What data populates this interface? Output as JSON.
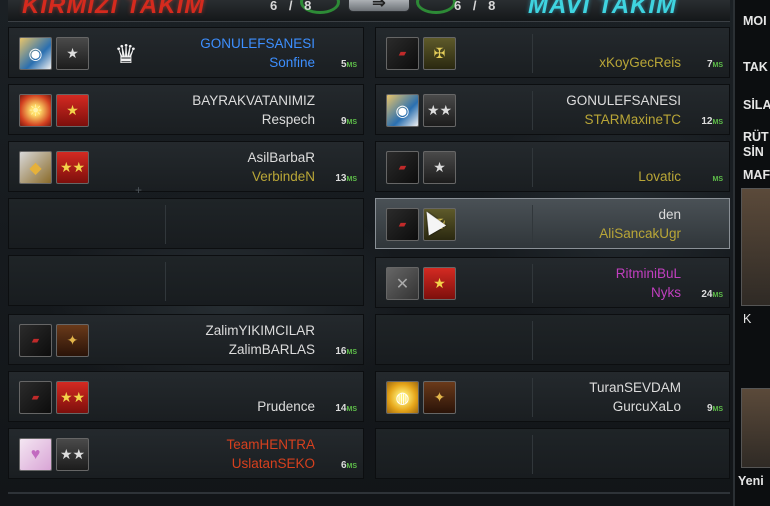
{
  "header": {
    "red_team": "KIRMIZI TAKIM",
    "red_count": "6 / 8",
    "blue_team": "MAVİ TAKIM",
    "blue_count": "6 / 8",
    "swap_label": "⇒"
  },
  "red_slots": [
    {
      "name1": "GONULEFSANESI",
      "name2": "Sonfine",
      "ping": "5",
      "name1_color": "blue",
      "name2_color": "blue"
    },
    {
      "name1": "BAYRAKVATANIMIZ",
      "name2": "Respech",
      "ping": "9"
    },
    {
      "name1": "AsilBarbaR",
      "name2": "VerbindeN",
      "ping": "13"
    },
    {
      "empty": true
    },
    {
      "empty": true
    },
    {
      "name1": "ZalimYIKIMCILAR",
      "name2": "ZalimBARLAS",
      "ping": "16"
    },
    {
      "name1": "",
      "name2": "Prudence",
      "ping": "14"
    },
    {
      "name1": "TeamHENTRA",
      "name2": "UslatanSEKO",
      "ping": "6"
    }
  ],
  "blue_slots": [
    {
      "name1": "",
      "name2": "xKoyGecReis",
      "ping": "7"
    },
    {
      "name1": "GONULEFSANESI",
      "name2": "STARMaxineTC",
      "ping": "12"
    },
    {
      "name1": "",
      "name2": "Lovatic",
      "ping": ""
    },
    {
      "name1": "den",
      "name2": "AliSancakUgr",
      "ping": ""
    },
    {
      "name1": "RitminiBuL",
      "name2": "Nyks",
      "ping": "24"
    },
    {
      "empty": true
    },
    {
      "name1": "TuranSEVDAM",
      "name2": "GurcuXaLo",
      "ping": "9"
    },
    {
      "empty": true
    }
  ],
  "ping_unit": "MS",
  "side_panel": {
    "items": [
      "MOI",
      "TAK",
      "SİLA",
      "RÜT",
      "SİN",
      "MAF"
    ],
    "thumb_label": "K",
    "bottom_label": "Yeni"
  },
  "icons": {
    "clan": "crown-wings-icon",
    "rank_star": "star-icon"
  }
}
